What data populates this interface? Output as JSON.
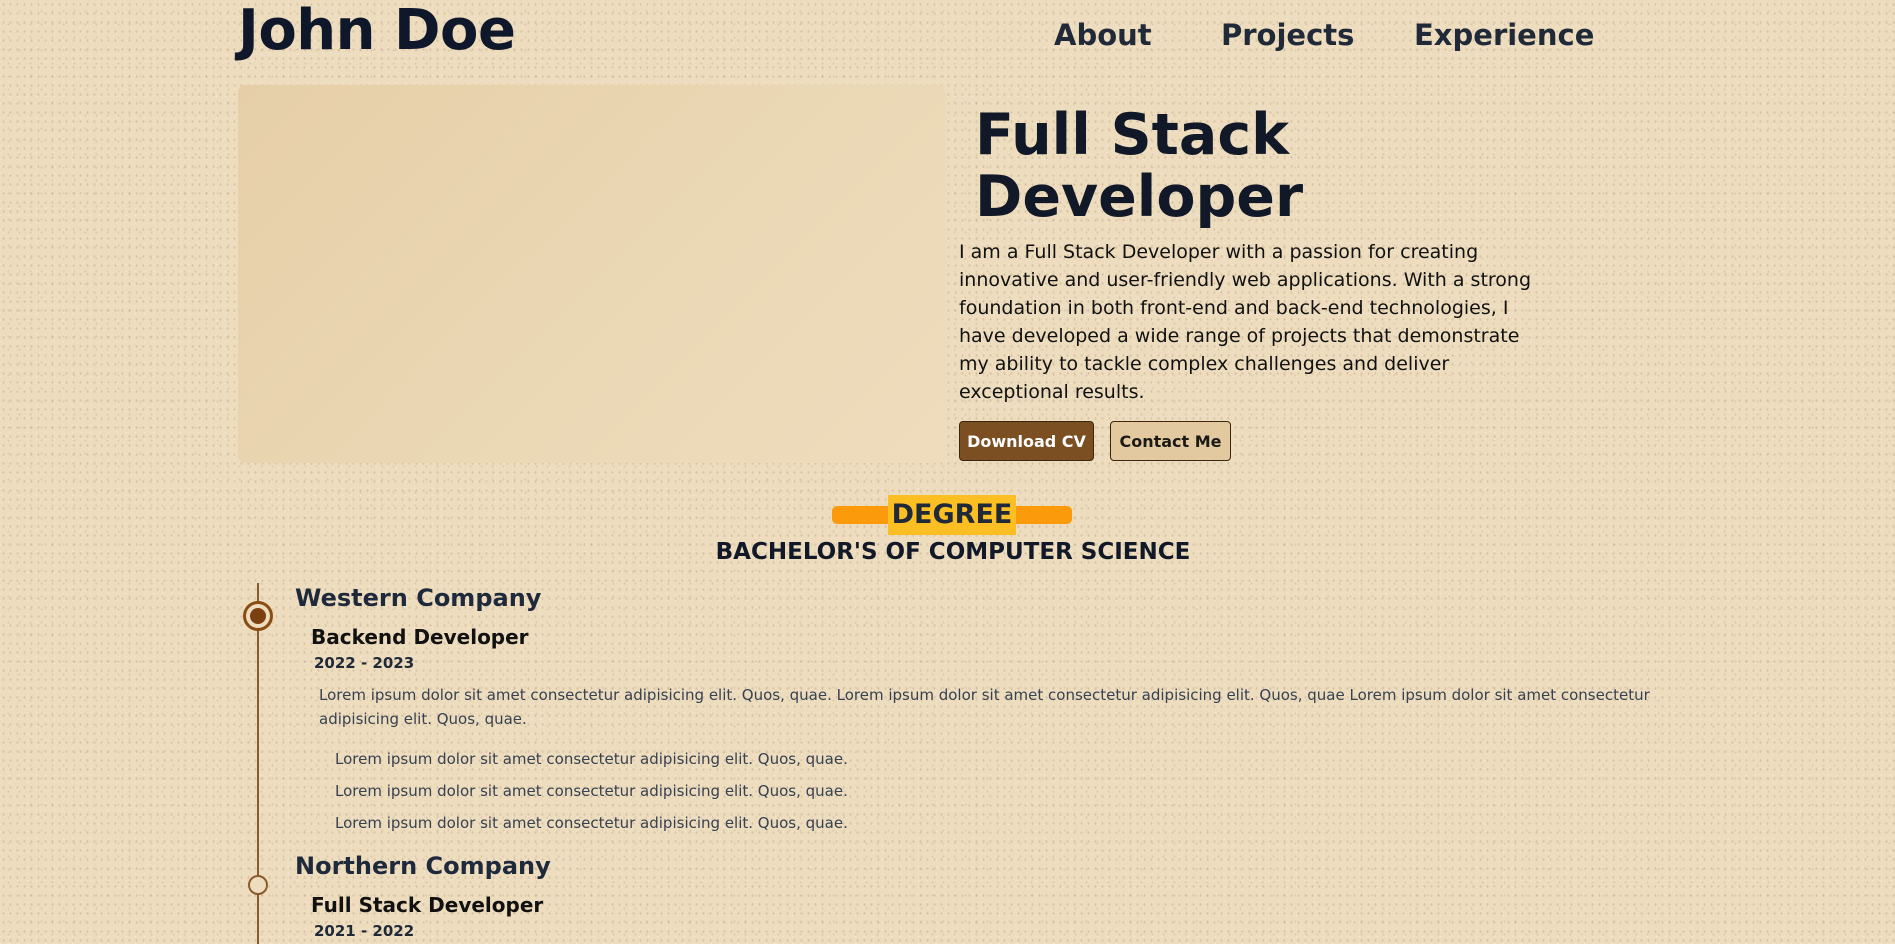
{
  "header": {
    "name": "John Doe",
    "nav": [
      "About",
      "Projects",
      "Experience"
    ]
  },
  "hero": {
    "title": "Full Stack Developer",
    "description": "I am a Full Stack Developer with a passion for creating innovative and user-friendly web applications. With a strong foundation in both front-end and back-end technologies, I have developed a wide range of projects that demonstrate my ability to tackle complex challenges and deliver exceptional results.",
    "primary_button": "Download CV",
    "secondary_button": "Contact Me"
  },
  "education": {
    "label": "DEGREE",
    "degree": "BACHELOR'S OF COMPUTER SCIENCE"
  },
  "experience": [
    {
      "company": "Western Company",
      "role": "Backend Developer",
      "years": "2022 - 2023",
      "description": "Lorem ipsum dolor sit amet consectetur adipisicing elit. Quos, quae. Lorem ipsum dolor sit amet consectetur adipisicing elit. Quos, quae Lorem ipsum dolor sit amet consectetur adipisicing elit. Quos, quae.",
      "highlights": [
        "Lorem ipsum dolor sit amet consectetur adipisicing elit. Quos, quae.",
        "Lorem ipsum dolor sit amet consectetur adipisicing elit. Quos, quae.",
        "Lorem ipsum dolor sit amet consectetur adipisicing elit. Quos, quae."
      ]
    },
    {
      "company": "Northern Company",
      "role": "Full Stack Developer",
      "years": "2021 - 2022"
    }
  ],
  "colors": {
    "background": "#eddcbd",
    "accent_brown": "#7c4f22",
    "degree_orange": "#fb9a0a",
    "degree_yellow": "#fbbf24"
  }
}
